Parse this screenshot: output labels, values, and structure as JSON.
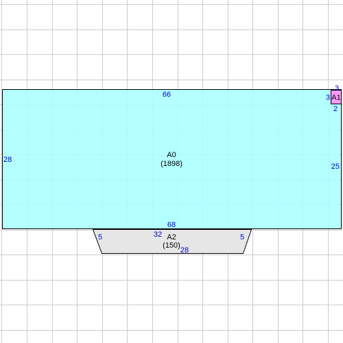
{
  "colors": {
    "background": "#ffffff",
    "grid_line": "#cccccc",
    "outline": "#000000",
    "dimension_text": "#0000cc",
    "room_label_text": "#000000"
  },
  "rooms": [
    {
      "id": "A0",
      "label": "A0",
      "area": "(1898)",
      "fill": "#aaffff",
      "dimensions": {
        "top": "66",
        "bottom": "68",
        "left": "28",
        "right": "25"
      }
    },
    {
      "id": "A1",
      "label": "A1",
      "fill": "#ff99ff",
      "dimensions": {
        "top": "3",
        "left": "3",
        "bottom": "2"
      }
    },
    {
      "id": "A2",
      "label": "A2",
      "area": "(150)",
      "fill": "#e6e6e6",
      "dimensions": {
        "top": "32",
        "bottom": "28",
        "left": "5",
        "right": "5"
      }
    }
  ]
}
